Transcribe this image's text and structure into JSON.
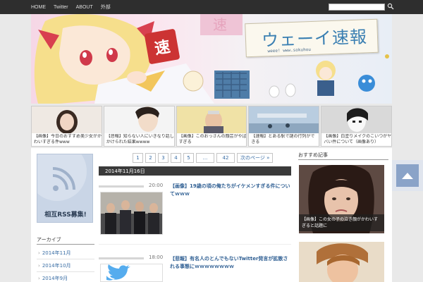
{
  "nav": {
    "items": [
      "HOME",
      "Twitter",
      "ABOUT",
      "外部"
    ],
    "search_placeholder": ""
  },
  "header": {
    "logo_title": "ウェーイ速報",
    "logo_subtitle": "weee! www.sokuhou",
    "armband_text": "速"
  },
  "featured": [
    {
      "caption": "【画像】今日のおすすめ美少女がかわいすぎる件www"
    },
    {
      "caption": "【悲報】知らない人にいきなり話しかけられた結果wwww"
    },
    {
      "caption": "【画像】このおっさんの顔芸がやばすぎる"
    },
    {
      "caption": "【速報】とある駅で謎の行列ができる"
    },
    {
      "caption": "【画像】白塗りメイクのこいつがヤバい件について（画像あり）"
    }
  ],
  "sidebar_left": {
    "rss_label": "相互RSS募集!",
    "archive_title": "アーカイブ",
    "archive_items": [
      "2014年11月",
      "2014年10月",
      "2014年9月"
    ]
  },
  "pagination": {
    "pages": [
      "1",
      "2",
      "3",
      "4",
      "5",
      "...",
      "42"
    ],
    "next_label": "次のページ »"
  },
  "date_header": "2014年11月16日",
  "posts": [
    {
      "time": "20:00",
      "title": "【画像】19歳の頃の俺たちがイケメンすぎる件についてｗｗｗ"
    },
    {
      "time": "18:00",
      "title": "【悲報】有名人のとんでもないTwitter発言が拡散される事態にｗｗｗｗｗｗｗｗ"
    }
  ],
  "sidebar_right": {
    "title": "おすすめ記事",
    "cards": [
      {
        "caption": "【画像】この女の子の泣き顔がかわいすぎると話題に"
      },
      {
        "caption": ""
      }
    ]
  },
  "colors": {
    "nav_bg": "#2e2e2e",
    "link": "#2f5f93",
    "date_bar": "#3a3a3a",
    "rss_box": "#c9d5e6",
    "scroll_top": "#8aa3c8"
  }
}
